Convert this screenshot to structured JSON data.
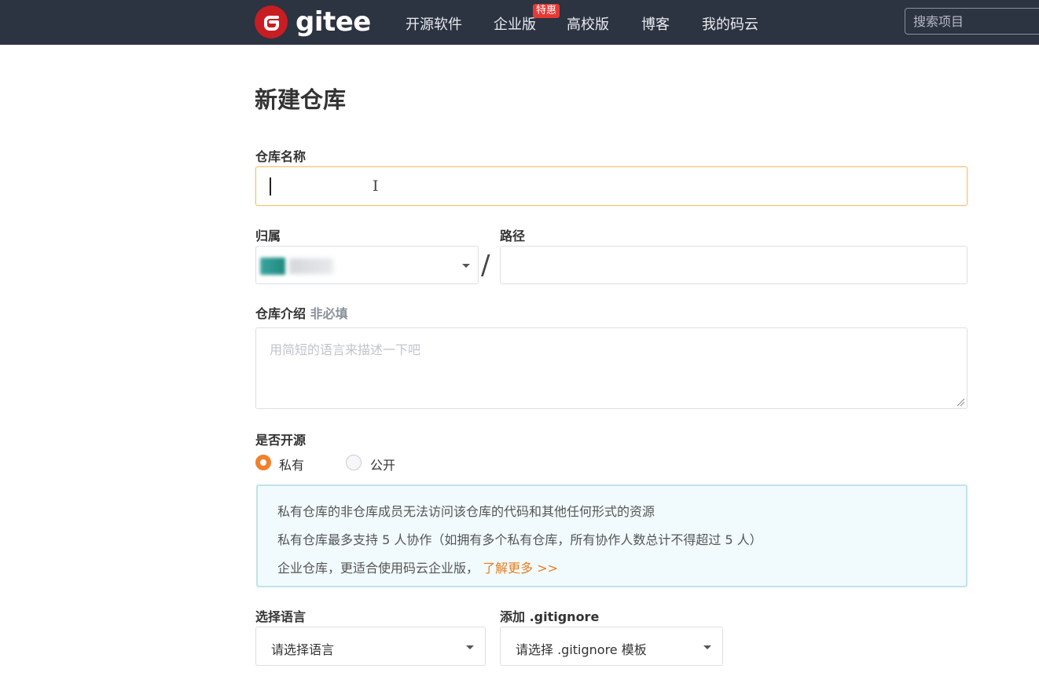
{
  "header": {
    "logo_letter": "G",
    "logo_text": "gitee",
    "nav": [
      "开源软件",
      "企业版",
      "高校版",
      "博客",
      "我的码云"
    ],
    "badge": "特惠",
    "search_placeholder": "搜索项目",
    "brand_color": "#c71d23",
    "bar_color": "#2c3341"
  },
  "form": {
    "title": "新建仓库",
    "name_label": "仓库名称",
    "owner_label": "归属",
    "path_label": "路径",
    "separator": "/",
    "desc_label": "仓库介绍",
    "desc_optional": "非必填",
    "desc_placeholder": "用简短的语言来描述一下吧",
    "visibility_label": "是否开源",
    "visibility_options": [
      {
        "label": "私有",
        "selected": true
      },
      {
        "label": "公开",
        "selected": false
      }
    ],
    "info": {
      "line1": "私有仓库的非仓库成员无法访问该仓库的代码和其他任何形式的资源",
      "line2": "私有仓库最多支持 5 人协作（如拥有多个私有仓库，所有协作人数总计不得超过 5 人）",
      "line3": "企业仓库，更适合使用码云企业版，",
      "link": "了解更多 >>"
    },
    "language_label": "选择语言",
    "language_placeholder": "请选择语言",
    "gitignore_label": "添加 .gitignore",
    "gitignore_placeholder": "请选择 .gitignore 模板",
    "accent_color": "#f0812d",
    "link_color": "#e67e22"
  }
}
